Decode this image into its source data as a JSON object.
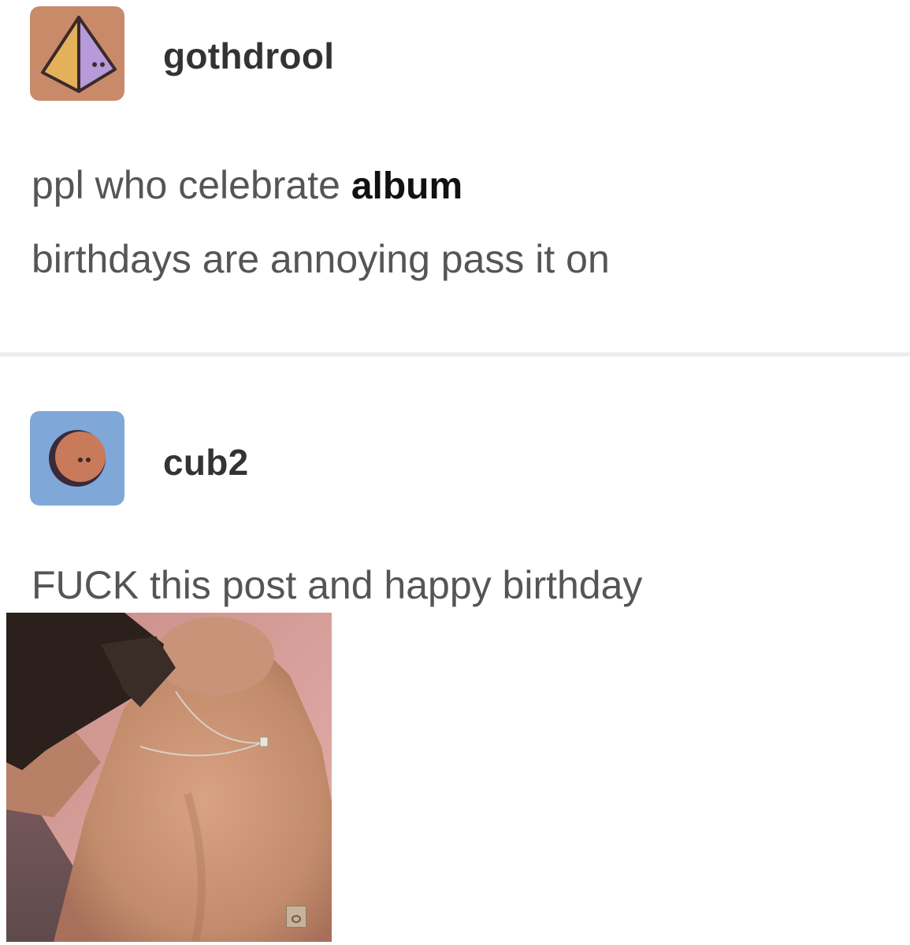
{
  "posts": [
    {
      "username": "gothdrool",
      "avatar_icon": "pyramid-icon",
      "avatar_bg": "#c98a6a",
      "text_parts": [
        "ppl who celebrate ",
        "album",
        "birthdays are annoying pass it on"
      ]
    },
    {
      "username": "cub2",
      "avatar_icon": "circle-face-icon",
      "avatar_bg": "#7fa8d9",
      "text": "FUCK this post and happy birthday"
    }
  ],
  "album_cover": {
    "icon": "album-cover-image",
    "colors": {
      "background": "#d9a0a0",
      "skin": "#c98f72",
      "hair": "#2b201c"
    }
  }
}
